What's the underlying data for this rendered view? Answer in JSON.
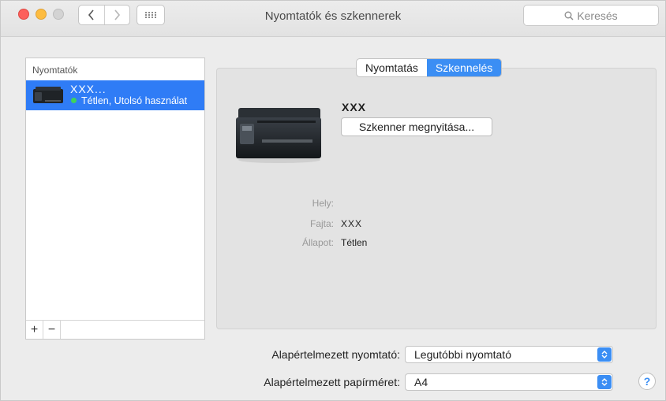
{
  "window": {
    "title": "Nyomtatók és szkennerek"
  },
  "search": {
    "placeholder": "Keresés"
  },
  "sidebar": {
    "header": "Nyomtatók",
    "printers": [
      {
        "name": "XXX...",
        "status": "Tétlen, Utolsó használat"
      }
    ],
    "add_label": "+",
    "remove_label": "−"
  },
  "tabs": [
    {
      "label": "Nyomtatás",
      "active": false
    },
    {
      "label": "Szkennelés",
      "active": true
    }
  ],
  "device": {
    "name": "XXX",
    "open_button": "Szkenner megnyitása...",
    "info": [
      {
        "label": "Hely:",
        "value": ""
      },
      {
        "label": "Fajta:",
        "value": "XXX"
      },
      {
        "label": "Állapot:",
        "value": "Tétlen"
      }
    ]
  },
  "settings": {
    "default_printer_label": "Alapértelmezett nyomtató:",
    "default_printer_value": "Legutóbbi nyomtató",
    "default_paper_label": "Alapértelmezett papírméret:",
    "default_paper_value": "A4"
  },
  "help": {
    "label": "?"
  },
  "colors": {
    "accent": "#3b8ef4",
    "selection": "#2f7cf6",
    "status_dot": "#3fd35b"
  }
}
